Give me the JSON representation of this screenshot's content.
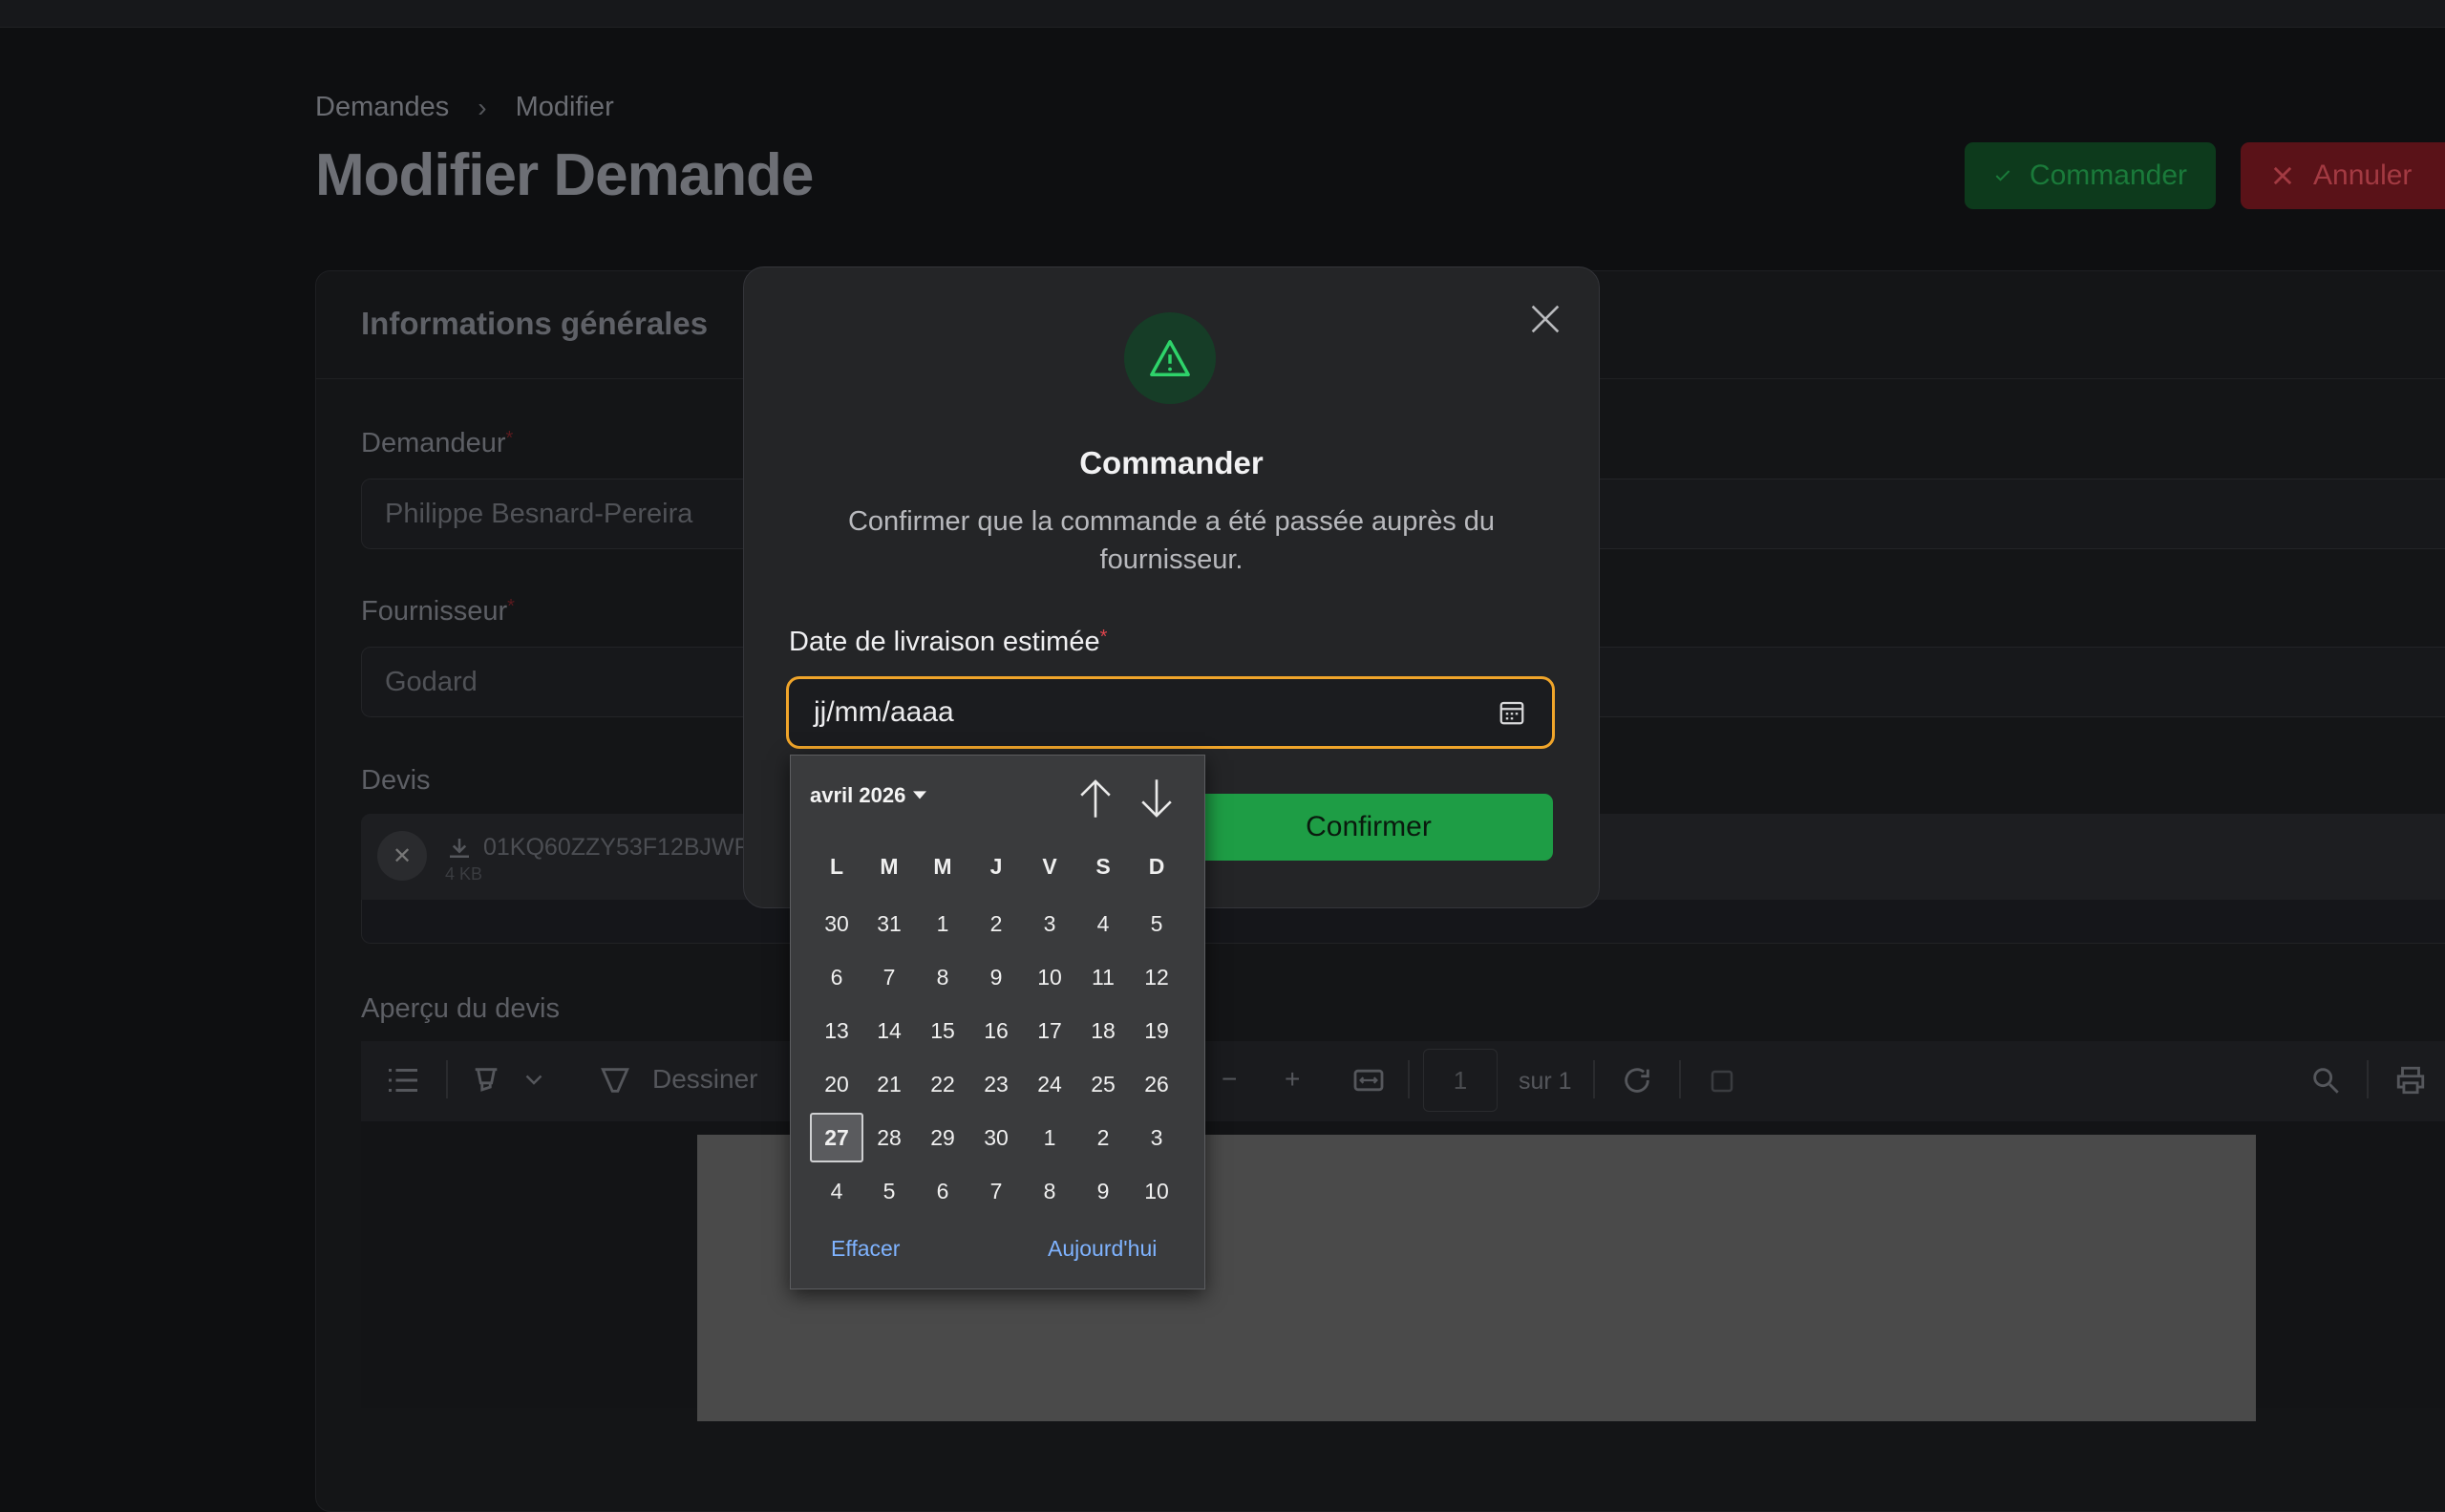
{
  "breadcrumb": {
    "root": "Demandes",
    "sep": "›",
    "current": "Modifier"
  },
  "page": {
    "title": "Modifier Demande"
  },
  "header_actions": {
    "order": "Commander",
    "cancel": "Annuler"
  },
  "section": {
    "title": "Informations générales"
  },
  "form": {
    "requester_label": "Demandeur",
    "requester_value": "Philippe Besnard-Pereira",
    "supplier_label": "Fournisseur",
    "supplier_value": "Godard",
    "quote_label": "Devis",
    "quote_file": "01KQ60ZZY53F12BJWF",
    "quote_size": "4 KB",
    "preview_label": "Aperçu du devis",
    "required_mark": "*"
  },
  "pdf_toolbar": {
    "draw": "Dessiner",
    "page": "1",
    "of": "sur 1"
  },
  "modal": {
    "title": "Commander",
    "description": "Confirmer que la commande a été passée auprès du fournisseur.",
    "date_label": "Date de livraison estimée",
    "required_mark": "*",
    "date_placeholder": "jj/mm/aaaa",
    "confirm": "Confirmer"
  },
  "calendar": {
    "month": "avril 2026",
    "weekdays": [
      "L",
      "M",
      "M",
      "J",
      "V",
      "S",
      "D"
    ],
    "weeks": [
      [
        "30",
        "31",
        "1",
        "2",
        "3",
        "4",
        "5"
      ],
      [
        "6",
        "7",
        "8",
        "9",
        "10",
        "11",
        "12"
      ],
      [
        "13",
        "14",
        "15",
        "16",
        "17",
        "18",
        "19"
      ],
      [
        "20",
        "21",
        "22",
        "23",
        "24",
        "25",
        "26"
      ],
      [
        "27",
        "28",
        "29",
        "30",
        "1",
        "2",
        "3"
      ],
      [
        "4",
        "5",
        "6",
        "7",
        "8",
        "9",
        "10"
      ]
    ],
    "selected": "27",
    "clear": "Effacer",
    "today": "Aujourd'hui"
  },
  "colors": {
    "accent_green": "#1e9d45",
    "focus_orange": "#f0a52a",
    "danger": "#e0454d",
    "link_blue": "#7fb3ff"
  }
}
